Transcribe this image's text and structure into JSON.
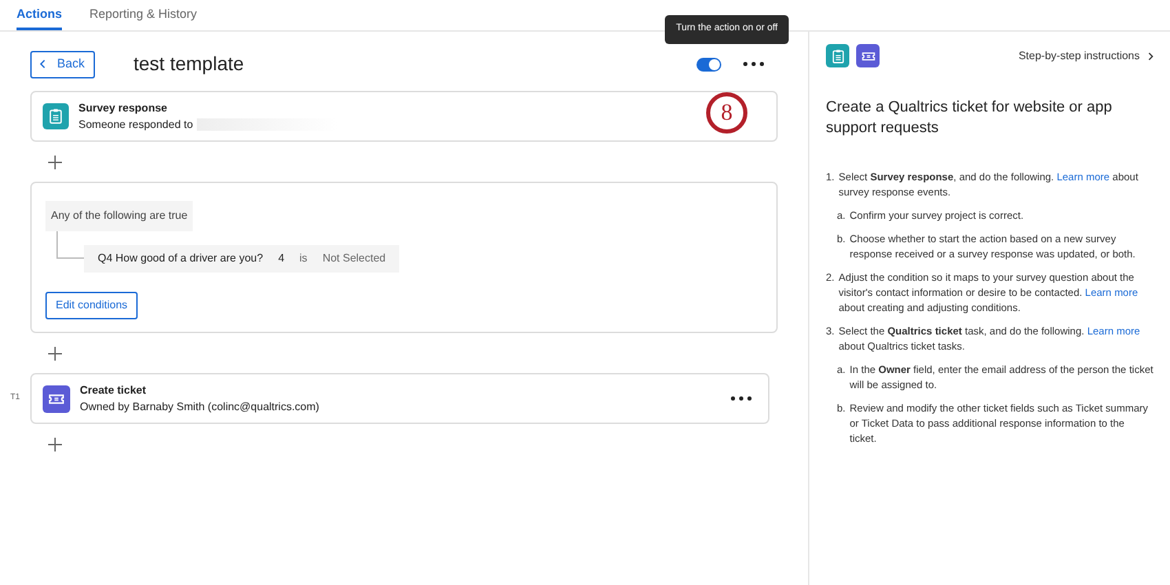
{
  "tabs": [
    {
      "label": "Actions",
      "selected": true
    },
    {
      "label": "Reporting & History",
      "selected": false
    }
  ],
  "header": {
    "back": "Back",
    "title": "test template",
    "toggle": {
      "on": true
    },
    "tooltip": "Turn the action on or off",
    "callout": "8"
  },
  "event": {
    "title": "Survey response",
    "subtitle": "Someone responded to"
  },
  "conditions": {
    "group": "Any of the following are true",
    "rows": [
      {
        "question": "Q4 How good of a driver are you?",
        "value": "4",
        "operator": "is",
        "answer": "Not Selected"
      }
    ],
    "edit": "Edit conditions"
  },
  "task": {
    "label": "T1",
    "title": "Create ticket",
    "subtitle": "Owned by Barnaby Smith (colinc@qualtrics.com)"
  },
  "instructions": {
    "link": "Step-by-step instructions",
    "heading": "Create a Qualtrics ticket for website or app support requests",
    "steps": [
      {
        "number": "1.",
        "before": "Select **Survey response**, and do the following.",
        "link": "Learn more",
        "after": "about survey response events.",
        "substeps": [
          {
            "letter": "a.",
            "text": "Confirm your survey project is correct."
          },
          {
            "letter": "b.",
            "text": "Choose whether to start the action based on a new survey response received or a survey response was updated, or both."
          }
        ]
      },
      {
        "number": "2.",
        "before": "Adjust the condition so it maps to your survey question about the visitor's contact information or desire to be contacted.",
        "link": "Learn more",
        "after": "about creating and adjusting conditions."
      },
      {
        "number": "3.",
        "before": "Select the **Qualtrics ticket** task, and do the following.",
        "link": "Learn more",
        "after": "about Qualtrics ticket tasks.",
        "substeps": [
          {
            "letter": "a.",
            "text": "In the **Owner** field, enter the email address of the person the ticket will be assigned to."
          },
          {
            "letter": "b.",
            "text": "Review and modify the other ticket fields such as Ticket summary or Ticket Data to pass additional response information to the ticket."
          }
        ]
      }
    ]
  }
}
